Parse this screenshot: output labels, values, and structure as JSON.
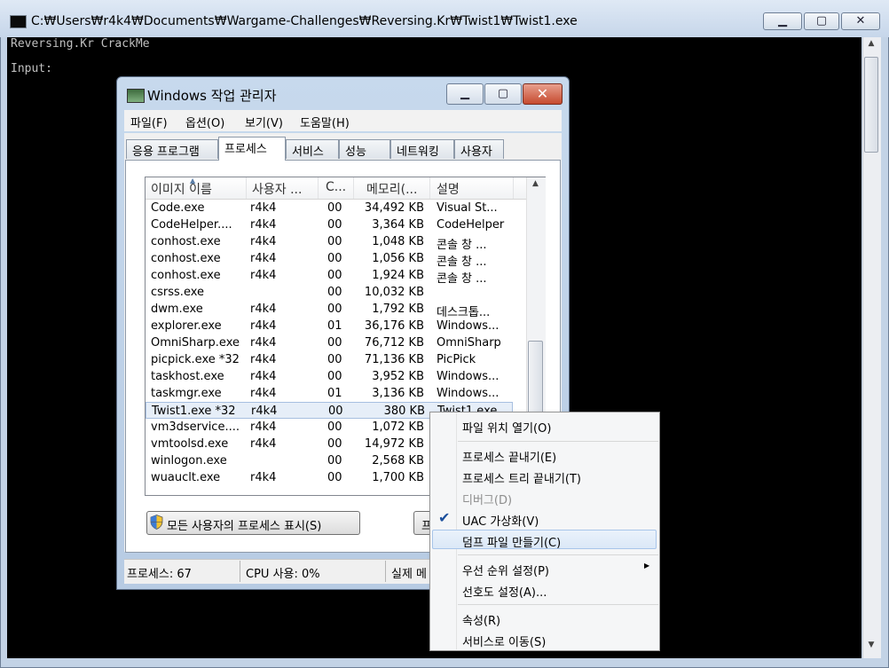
{
  "console": {
    "title": "C:₩Users₩r4k4₩Documents₩Wargame-Challenges₩Reversing.Kr₩Twist1₩Twist1.exe",
    "lines": [
      "Reversing.Kr CrackMe",
      "Input:"
    ]
  },
  "taskmgr": {
    "title": "Windows 작업 관리자",
    "menu": [
      "파일(F)",
      "옵션(O)",
      "보기(V)",
      "도움말(H)"
    ],
    "tabs": [
      "응용 프로그램",
      "프로세스",
      "서비스",
      "성능",
      "네트워킹",
      "사용자"
    ],
    "active_tab": "프로세스",
    "columns": [
      "이미지 이름",
      "사용자 ...",
      "C...",
      "메모리(...",
      "설명"
    ],
    "rows": [
      {
        "name": "Code.exe",
        "user": "r4k4",
        "cpu": "00",
        "mem": "34,492 KB",
        "desc": "Visual St..."
      },
      {
        "name": "CodeHelper....",
        "user": "r4k4",
        "cpu": "00",
        "mem": "3,364 KB",
        "desc": "CodeHelper"
      },
      {
        "name": "conhost.exe",
        "user": "r4k4",
        "cpu": "00",
        "mem": "1,048 KB",
        "desc": "콘솔 창 ..."
      },
      {
        "name": "conhost.exe",
        "user": "r4k4",
        "cpu": "00",
        "mem": "1,056 KB",
        "desc": "콘솔 창 ..."
      },
      {
        "name": "conhost.exe",
        "user": "r4k4",
        "cpu": "00",
        "mem": "1,924 KB",
        "desc": "콘솔 창 ..."
      },
      {
        "name": "csrss.exe",
        "user": "",
        "cpu": "00",
        "mem": "10,032 KB",
        "desc": ""
      },
      {
        "name": "dwm.exe",
        "user": "r4k4",
        "cpu": "00",
        "mem": "1,792 KB",
        "desc": "데스크톱..."
      },
      {
        "name": "explorer.exe",
        "user": "r4k4",
        "cpu": "01",
        "mem": "36,176 KB",
        "desc": "Windows..."
      },
      {
        "name": "OmniSharp.exe",
        "user": "r4k4",
        "cpu": "00",
        "mem": "76,712 KB",
        "desc": "OmniSharp"
      },
      {
        "name": "picpick.exe *32",
        "user": "r4k4",
        "cpu": "00",
        "mem": "71,136 KB",
        "desc": "PicPick"
      },
      {
        "name": "taskhost.exe",
        "user": "r4k4",
        "cpu": "00",
        "mem": "3,952 KB",
        "desc": "Windows..."
      },
      {
        "name": "taskmgr.exe",
        "user": "r4k4",
        "cpu": "01",
        "mem": "3,136 KB",
        "desc": "Windows..."
      },
      {
        "name": "Twist1.exe *32",
        "user": "r4k4",
        "cpu": "00",
        "mem": "380 KB",
        "desc": "Twist1.exe"
      },
      {
        "name": "vm3dservice....",
        "user": "r4k4",
        "cpu": "00",
        "mem": "1,072 KB",
        "desc": ""
      },
      {
        "name": "vmtoolsd.exe",
        "user": "r4k4",
        "cpu": "00",
        "mem": "14,972 KB",
        "desc": ""
      },
      {
        "name": "winlogon.exe",
        "user": "",
        "cpu": "00",
        "mem": "2,568 KB",
        "desc": ""
      },
      {
        "name": "wuauclt.exe",
        "user": "r4k4",
        "cpu": "00",
        "mem": "1,700 KB",
        "desc": ""
      }
    ],
    "selected_row": 12,
    "show_all_button": "모든 사용자의 프로세스 표시(S)",
    "end_process_button": "프",
    "status": {
      "processes": "프로세스: 67",
      "cpu": "CPU 사용: 0%",
      "memory": "실제 메"
    }
  },
  "context_menu": {
    "items": [
      {
        "label": "파일 위치 열기(O)",
        "enabled": true
      },
      {
        "label": "프로세스 끝내기(E)",
        "enabled": true
      },
      {
        "label": "프로세스 트리 끝내기(T)",
        "enabled": true
      },
      {
        "label": "디버그(D)",
        "enabled": false
      },
      {
        "label": "UAC 가상화(V)",
        "enabled": true,
        "checked": true
      },
      {
        "label": "덤프 파일 만들기(C)",
        "enabled": true,
        "highlighted": true
      },
      {
        "label": "우선 순위 설정(P)",
        "enabled": true,
        "submenu": true
      },
      {
        "label": "선호도 설정(A)...",
        "enabled": true
      },
      {
        "label": "속성(R)",
        "enabled": true
      },
      {
        "label": "서비스로 이동(S)",
        "enabled": true
      }
    ]
  }
}
